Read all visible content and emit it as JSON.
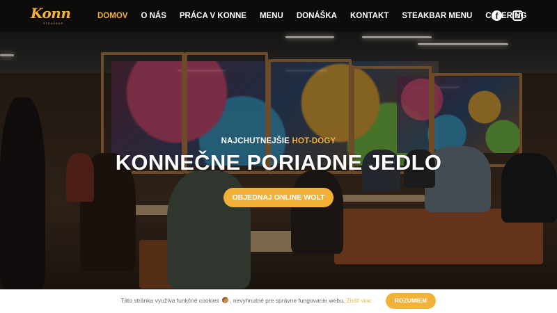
{
  "logo": {
    "text": "Konn",
    "subtext": "STEAKBAR"
  },
  "nav": {
    "items": [
      {
        "label": "DOMOV",
        "active": true
      },
      {
        "label": "O NÁS",
        "active": false
      },
      {
        "label": "PRÁCA V KONNE",
        "active": false
      },
      {
        "label": "MENU",
        "active": false
      },
      {
        "label": "DONÁŠKA",
        "active": false
      },
      {
        "label": "KONTAKT",
        "active": false
      },
      {
        "label": "STEAKBAR MENU",
        "active": false
      },
      {
        "label": "CATERING",
        "active": false
      }
    ],
    "social": {
      "facebook_icon": "facebook-icon",
      "instagram_icon": "instagram-icon",
      "facebook_glyph": "f"
    }
  },
  "hero": {
    "eyebrow_prefix": "NAJCHUTNEJŠIE",
    "eyebrow_highlight": "HOT-DOGY",
    "headline": "KONNEČNE PORIADNE JEDLO",
    "cta_label": "OBJEDNAJ ONLINE WOLT"
  },
  "cookie": {
    "text_before": "Táto stránka využíva funkčné cookies",
    "text_after": ", nevyhnutné pre správne fungovanie webu.",
    "link_label": "Zistiť viac",
    "button_label": "ROZUMIEM"
  },
  "colors": {
    "accent": "#f2b23a",
    "nav_bg": "#0a0a0a",
    "text": "#ffffff"
  }
}
